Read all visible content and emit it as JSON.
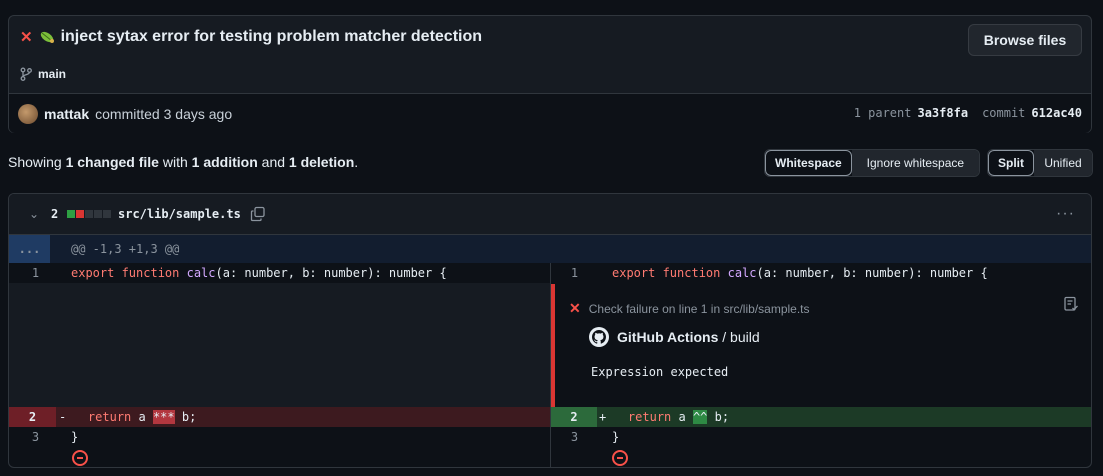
{
  "commit": {
    "status_icon": "x-icon",
    "emoji_icon": "bug-emoji-icon",
    "title": "inject sytax error for testing problem matcher detection",
    "browse_label": "Browse files",
    "branch": "main",
    "author": "mattak",
    "committed_text": "committed 3 days ago",
    "parent_label": "1 parent",
    "parent_sha": "3a3f8fa",
    "commit_label": "commit",
    "commit_sha": "612ac40"
  },
  "summary": {
    "showing": "Showing",
    "changed": "1 changed file",
    "with": "with",
    "additions": "1 addition",
    "and": "and",
    "deletions": "1 deletion",
    "period": "."
  },
  "toggles": {
    "whitespace": "Whitespace",
    "ignore_whitespace": "Ignore whitespace",
    "split": "Split",
    "unified": "Unified"
  },
  "file": {
    "change_count": "2",
    "path": "src/lib/sample.ts",
    "kebab": "···",
    "hunk_expand": "...",
    "hunk_header": "@@ -1,3 +1,3 @@",
    "colors": {
      "add": "#2ea043",
      "del": "#da3633",
      "neutral": "#30363d"
    }
  },
  "diff": {
    "left": [
      {
        "num": "1",
        "sign": "",
        "pre": "",
        "kw": "export function ",
        "fn": "calc",
        "rest": "(a: number, b: number): number {"
      },
      {
        "num": "2",
        "sign": "-",
        "pre": "  ",
        "kw": "return ",
        "fn": "",
        "rest": "a ",
        "hl": "***",
        "post": " b;"
      },
      {
        "num": "3",
        "sign": "",
        "pre": "",
        "kw": "",
        "fn": "",
        "rest": "}"
      }
    ],
    "right": [
      {
        "num": "1",
        "sign": "",
        "pre": "",
        "kw": "export function ",
        "fn": "calc",
        "rest": "(a: number, b: number): number {"
      },
      {
        "num": "2",
        "sign": "+",
        "pre": "  ",
        "kw": "return ",
        "fn": "",
        "rest": "a ",
        "hl": "^^",
        "post": " b;"
      },
      {
        "num": "3",
        "sign": "",
        "pre": "",
        "kw": "",
        "fn": "",
        "rest": "}"
      }
    ]
  },
  "annotation": {
    "title": "Check failure on line 1 in src/lib/sample.ts",
    "source_name": "GitHub Actions",
    "source_sep": " / ",
    "source_job": "build",
    "message": "Expression expected"
  }
}
